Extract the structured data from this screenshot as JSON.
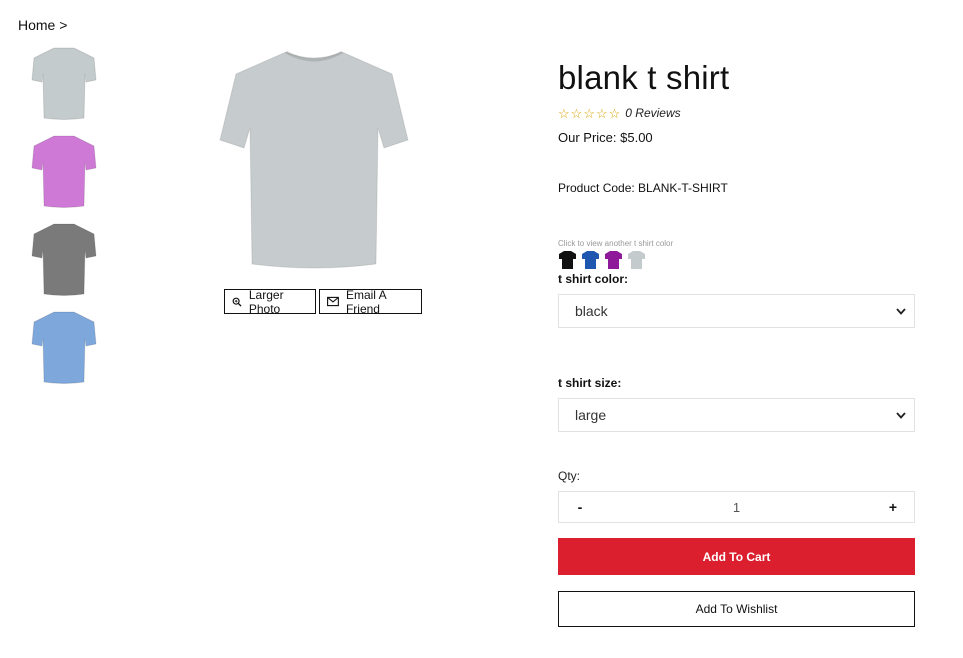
{
  "breadcrumb": {
    "home": "Home",
    "separator": ">"
  },
  "thumbnails": [
    {
      "color": "#c4cbcd",
      "alt": "grey t shirt"
    },
    {
      "color": "#cf79d6",
      "alt": "purple t shirt"
    },
    {
      "color": "#7a7a7a",
      "alt": "dark grey t shirt"
    },
    {
      "color": "#7ea7dc",
      "alt": "blue t shirt"
    }
  ],
  "main_image": {
    "color": "#c6cccd"
  },
  "image_buttons": {
    "larger_photo": "Larger Photo",
    "email_friend": "Email A Friend"
  },
  "product": {
    "title": "blank t shirt",
    "rating": {
      "stars": 0,
      "max": 5,
      "reviews_text": "0 Reviews"
    },
    "price_text": "Our Price: $5.00",
    "code_text": "Product Code: BLANK-T-SHIRT",
    "swatch_hint": "Click to view another t shirt color",
    "swatches": [
      {
        "name": "black",
        "color": "#111111"
      },
      {
        "name": "blue",
        "color": "#1e56b0"
      },
      {
        "name": "purple",
        "color": "#8e1a9a"
      },
      {
        "name": "grey",
        "color": "#c4cbcd"
      }
    ],
    "color_label": "t shirt color:",
    "color_value": "black",
    "size_label": "t shirt size:",
    "size_value": "large",
    "qty_label": "Qty:",
    "qty_minus": "-",
    "qty_value": "1",
    "qty_plus": "+",
    "add_to_cart": "Add To Cart",
    "add_to_wishlist": "Add To Wishlist"
  },
  "colors": {
    "accent": "#dc1f2e",
    "star": "#d9a400"
  }
}
